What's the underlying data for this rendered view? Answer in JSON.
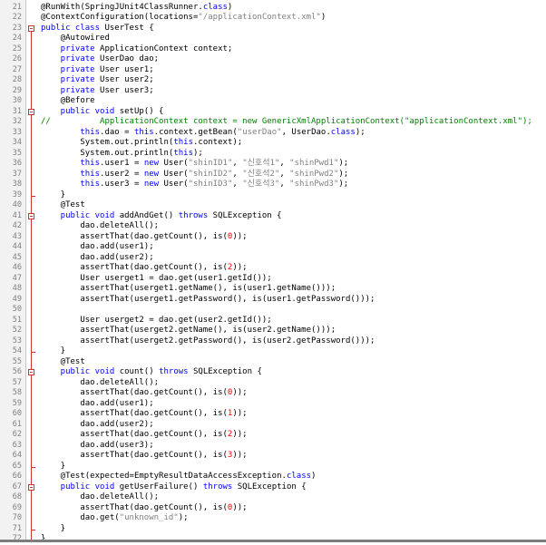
{
  "editor": {
    "lines": [
      {
        "n": "21",
        "segs": [
          [
            "a",
            "@RunWith(SpringJUnit4ClassRunner."
          ],
          [
            "k",
            "class"
          ],
          [
            "t",
            ")"
          ]
        ]
      },
      {
        "n": "22",
        "segs": [
          [
            "a",
            "@ContextConfiguration(locations="
          ],
          [
            "s",
            "\"/applicationContext.xml\""
          ],
          [
            "t",
            ")"
          ]
        ]
      },
      {
        "n": "23",
        "segs": [
          [
            "k",
            "public class "
          ],
          [
            "t",
            "UserTest {"
          ]
        ]
      },
      {
        "n": "24",
        "segs": [
          [
            "t",
            "    @Autowired"
          ]
        ]
      },
      {
        "n": "25",
        "segs": [
          [
            "k",
            "    private "
          ],
          [
            "t",
            "ApplicationContext context;"
          ]
        ]
      },
      {
        "n": "26",
        "segs": [
          [
            "k",
            "    private "
          ],
          [
            "t",
            "UserDao dao;"
          ]
        ]
      },
      {
        "n": "27",
        "segs": [
          [
            "k",
            "    private "
          ],
          [
            "t",
            "User user1;"
          ]
        ]
      },
      {
        "n": "28",
        "segs": [
          [
            "k",
            "    private "
          ],
          [
            "t",
            "User user2;"
          ]
        ]
      },
      {
        "n": "29",
        "segs": [
          [
            "k",
            "    private "
          ],
          [
            "t",
            "User user3;"
          ]
        ]
      },
      {
        "n": "30",
        "segs": [
          [
            "t",
            "    @Before"
          ]
        ]
      },
      {
        "n": "31",
        "segs": [
          [
            "k",
            "    public void "
          ],
          [
            "t",
            "setUp() {"
          ]
        ]
      },
      {
        "n": "32",
        "segs": [
          [
            "c",
            "//          ApplicationContext context = new GenericXmlApplicationContext(\"applicationContext.xml\");"
          ]
        ]
      },
      {
        "n": "33",
        "segs": [
          [
            "k",
            "        this"
          ],
          [
            "t",
            ".dao = "
          ],
          [
            "k",
            "this"
          ],
          [
            "t",
            ".context.getBean("
          ],
          [
            "s",
            "\"userDao\""
          ],
          [
            "t",
            ", UserDao."
          ],
          [
            "k",
            "class"
          ],
          [
            "t",
            ");"
          ]
        ]
      },
      {
        "n": "34",
        "segs": [
          [
            "t",
            "        System.out.println("
          ],
          [
            "k",
            "this"
          ],
          [
            "t",
            ".context);"
          ]
        ]
      },
      {
        "n": "35",
        "segs": [
          [
            "t",
            "        System.out.println("
          ],
          [
            "k",
            "this"
          ],
          [
            "t",
            ");"
          ]
        ]
      },
      {
        "n": "36",
        "segs": [
          [
            "k",
            "        this"
          ],
          [
            "t",
            ".user1 = "
          ],
          [
            "k",
            "new "
          ],
          [
            "t",
            "User("
          ],
          [
            "s",
            "\"shinID1\""
          ],
          [
            "t",
            ", "
          ],
          [
            "s",
            "\"신호석1\""
          ],
          [
            "t",
            ", "
          ],
          [
            "s",
            "\"shinPwd1\""
          ],
          [
            "t",
            ");"
          ]
        ]
      },
      {
        "n": "37",
        "segs": [
          [
            "k",
            "        this"
          ],
          [
            "t",
            ".user2 = "
          ],
          [
            "k",
            "new "
          ],
          [
            "t",
            "User("
          ],
          [
            "s",
            "\"shinID2\""
          ],
          [
            "t",
            ", "
          ],
          [
            "s",
            "\"신호석2\""
          ],
          [
            "t",
            ", "
          ],
          [
            "s",
            "\"shinPwd2\""
          ],
          [
            "t",
            ");"
          ]
        ]
      },
      {
        "n": "38",
        "segs": [
          [
            "k",
            "        this"
          ],
          [
            "t",
            ".user3 = "
          ],
          [
            "k",
            "new "
          ],
          [
            "t",
            "User("
          ],
          [
            "s",
            "\"shinID3\""
          ],
          [
            "t",
            ", "
          ],
          [
            "s",
            "\"신호석3\""
          ],
          [
            "t",
            ", "
          ],
          [
            "s",
            "\"shinPwd3\""
          ],
          [
            "t",
            ");"
          ]
        ]
      },
      {
        "n": "39",
        "segs": [
          [
            "t",
            "    }"
          ]
        ]
      },
      {
        "n": "40",
        "segs": [
          [
            "t",
            "    @Test"
          ]
        ]
      },
      {
        "n": "41",
        "segs": [
          [
            "k",
            "    public void "
          ],
          [
            "t",
            "addAndGet() "
          ],
          [
            "k",
            "throws "
          ],
          [
            "t",
            "SQLException {"
          ]
        ]
      },
      {
        "n": "42",
        "segs": [
          [
            "t",
            "        dao.deleteAll();"
          ]
        ]
      },
      {
        "n": "43",
        "segs": [
          [
            "t",
            "        assertThat(dao.getCount(), is("
          ],
          [
            "n",
            "0"
          ],
          [
            "t",
            "));"
          ]
        ]
      },
      {
        "n": "44",
        "segs": [
          [
            "t",
            "        dao.add(user1);"
          ]
        ]
      },
      {
        "n": "45",
        "segs": [
          [
            "t",
            "        dao.add(user2);"
          ]
        ]
      },
      {
        "n": "46",
        "segs": [
          [
            "t",
            "        assertThat(dao.getCount(), is("
          ],
          [
            "n",
            "2"
          ],
          [
            "t",
            "));"
          ]
        ]
      },
      {
        "n": "47",
        "segs": [
          [
            "t",
            "        User userget1 = dao.get(user1.getId());"
          ]
        ]
      },
      {
        "n": "48",
        "segs": [
          [
            "t",
            "        assertThat(userget1.getName(), is(user1.getName()));"
          ]
        ]
      },
      {
        "n": "49",
        "segs": [
          [
            "t",
            "        assertThat(userget1.getPassword(), is(user1.getPassword()));"
          ]
        ]
      },
      {
        "n": "50",
        "segs": [
          [
            "t",
            ""
          ]
        ]
      },
      {
        "n": "51",
        "segs": [
          [
            "t",
            "        User userget2 = dao.get(user2.getId());"
          ]
        ]
      },
      {
        "n": "52",
        "segs": [
          [
            "t",
            "        assertThat(userget2.getName(), is(user2.getName()));"
          ]
        ]
      },
      {
        "n": "53",
        "segs": [
          [
            "t",
            "        assertThat(userget2.getPassword(), is(user2.getPassword()));"
          ]
        ]
      },
      {
        "n": "54",
        "segs": [
          [
            "t",
            "    }"
          ]
        ]
      },
      {
        "n": "55",
        "segs": [
          [
            "t",
            "    @Test"
          ]
        ]
      },
      {
        "n": "56",
        "segs": [
          [
            "k",
            "    public void "
          ],
          [
            "t",
            "count() "
          ],
          [
            "k",
            "throws "
          ],
          [
            "t",
            "SQLException {"
          ]
        ]
      },
      {
        "n": "57",
        "segs": [
          [
            "t",
            "        dao.deleteAll();"
          ]
        ]
      },
      {
        "n": "58",
        "segs": [
          [
            "t",
            "        assertThat(dao.getCount(), is("
          ],
          [
            "n",
            "0"
          ],
          [
            "t",
            "));"
          ]
        ]
      },
      {
        "n": "59",
        "segs": [
          [
            "t",
            "        dao.add(user1);"
          ]
        ]
      },
      {
        "n": "60",
        "segs": [
          [
            "t",
            "        assertThat(dao.getCount(), is("
          ],
          [
            "n",
            "1"
          ],
          [
            "t",
            "));"
          ]
        ]
      },
      {
        "n": "61",
        "segs": [
          [
            "t",
            "        dao.add(user2);"
          ]
        ]
      },
      {
        "n": "62",
        "segs": [
          [
            "t",
            "        assertThat(dao.getCount(), is("
          ],
          [
            "n",
            "2"
          ],
          [
            "t",
            "));"
          ]
        ]
      },
      {
        "n": "63",
        "segs": [
          [
            "t",
            "        dao.add(user3);"
          ]
        ]
      },
      {
        "n": "64",
        "segs": [
          [
            "t",
            "        assertThat(dao.getCount(), is("
          ],
          [
            "n",
            "3"
          ],
          [
            "t",
            "));"
          ]
        ]
      },
      {
        "n": "65",
        "segs": [
          [
            "t",
            "    }"
          ]
        ]
      },
      {
        "n": "66",
        "segs": [
          [
            "t",
            "    @Test(expected=EmptyResultDataAccessException."
          ],
          [
            "k",
            "class"
          ],
          [
            "t",
            ")"
          ]
        ]
      },
      {
        "n": "67",
        "segs": [
          [
            "k",
            "    public void "
          ],
          [
            "t",
            "getUserFailure() "
          ],
          [
            "k",
            "throws "
          ],
          [
            "t",
            "SQLException {"
          ]
        ]
      },
      {
        "n": "68",
        "segs": [
          [
            "t",
            "        dao.deleteAll();"
          ]
        ]
      },
      {
        "n": "69",
        "segs": [
          [
            "t",
            "        assertThat(dao.getCount(), is("
          ],
          [
            "n",
            "0"
          ],
          [
            "t",
            "));"
          ]
        ]
      },
      {
        "n": "70",
        "segs": [
          [
            "t",
            "        dao.get("
          ],
          [
            "s",
            "\"unknown_id\""
          ],
          [
            "t",
            ");"
          ]
        ]
      },
      {
        "n": "71",
        "segs": [
          [
            "t",
            "    }"
          ]
        ]
      },
      {
        "n": "72",
        "segs": [
          [
            "t",
            "}"
          ]
        ]
      }
    ],
    "colors": {
      "keyword": "#0000ff",
      "string": "#808080",
      "number": "#ff0000",
      "comment": "#008000",
      "fold_marker": "#cc3333",
      "gutter_bg": "#f2f2f2"
    }
  }
}
